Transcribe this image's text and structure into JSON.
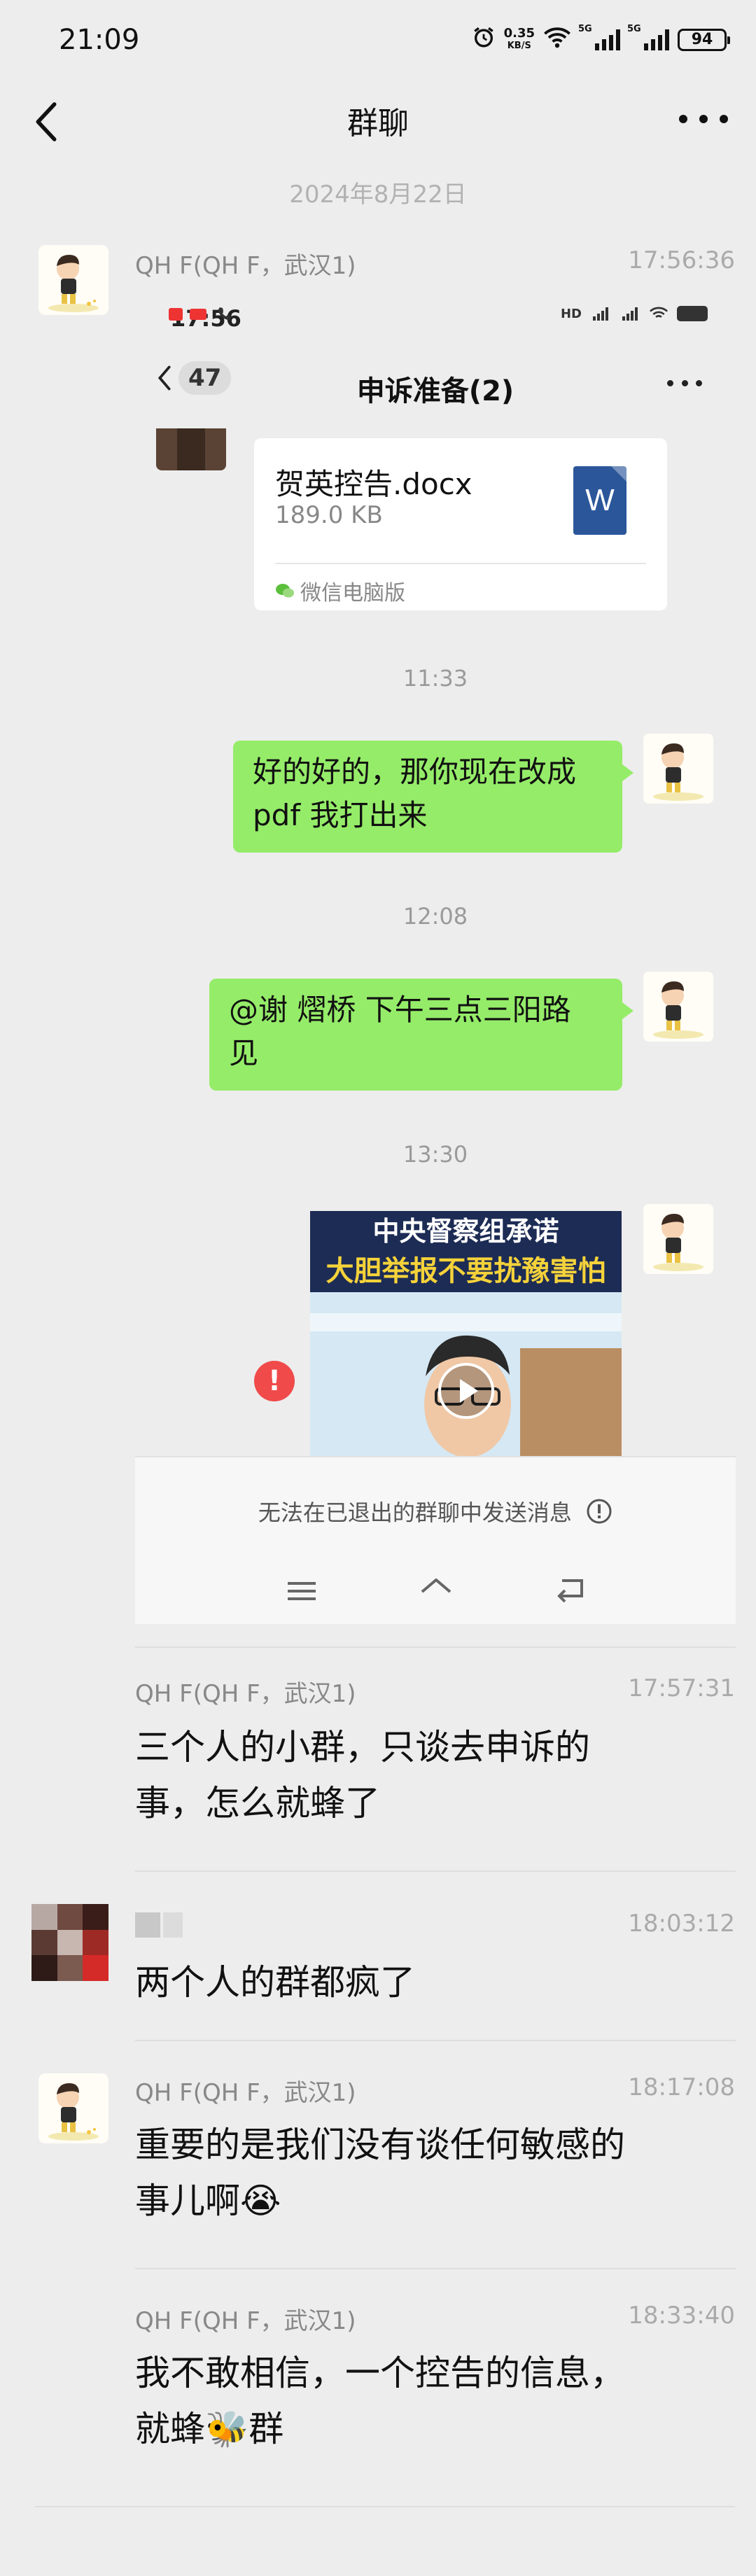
{
  "status_bar": {
    "time": "21:09",
    "net_speed_value": "0.35",
    "net_speed_unit": "KB/S",
    "signal1_label": "5G",
    "signal2_label": "5G",
    "battery": "94"
  },
  "nav": {
    "title": "群聊"
  },
  "date_divider": "2024年8月22日",
  "messages": [
    {
      "sender": "QH F(QH F，武汉1)",
      "time": "17:56:36",
      "type": "image-screenshot"
    },
    {
      "sender": "QH F(QH F，武汉1)",
      "time": "17:57:31",
      "text_line1": "三个人的小群，只谈去申诉的",
      "text_line2": "事，怎么就蜂了"
    },
    {
      "sender": "",
      "time": "18:03:12",
      "text_line1": "两个人的群都疯了"
    },
    {
      "sender": "QH F(QH F，武汉1)",
      "time": "18:17:08",
      "text_line1": "重要的是我们没有谈任何敏感的",
      "text_line2": "事儿啊😭"
    },
    {
      "sender": "QH F(QH F，武汉1)",
      "time": "18:33:40",
      "text_line1": "我不敢相信，一个控告的信息，",
      "text_line2": "就蜂🐝群"
    }
  ],
  "screenshot": {
    "status_time": "17:56",
    "chat_badge": "47",
    "chat_title": "申诉准备(2)",
    "file_name": "贺英控告.docx",
    "file_size": "189.0 KB",
    "file_icon_letter": "W",
    "file_source": "微信电脑版",
    "time1": "11:33",
    "bubble1_line1": "好的好的，那你现在改成",
    "bubble1_line2": "pdf 我打出来",
    "time2": "12:08",
    "bubble2_line1": "@谢 熠桥  下午三点三阳路",
    "bubble2_line2": "见",
    "time3": "13:30",
    "video_banner1": "中央督察组承诺",
    "video_banner2": "大胆举报不要扰豫害怕",
    "error_mark": "!",
    "footer_notice": "无法在已退出的群聊中发送消息"
  },
  "colors": {
    "background": "#ededed",
    "bubble_green": "#95ec69",
    "error_red": "#f04a4a",
    "word_blue": "#2b579a"
  }
}
